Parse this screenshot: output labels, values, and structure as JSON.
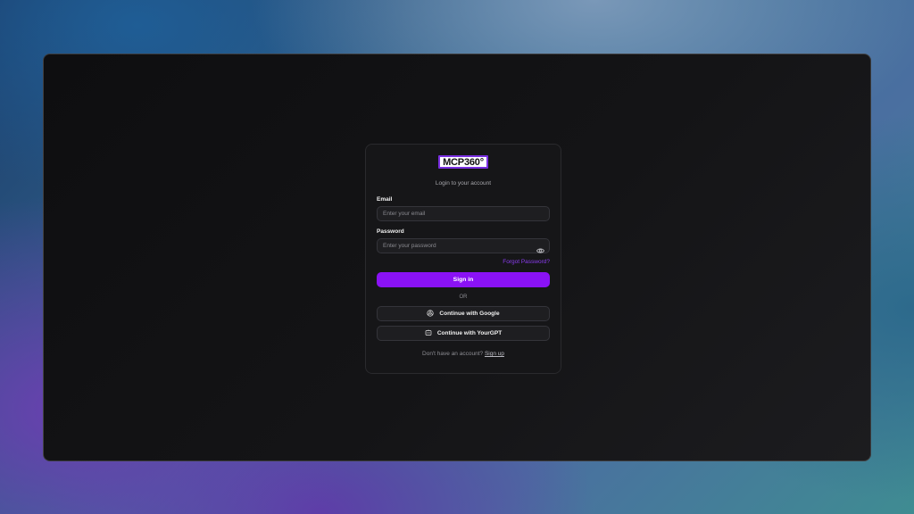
{
  "brand": {
    "logo_text": "MCP360°",
    "accent": "#8a12f5"
  },
  "login": {
    "subtitle": "Login to your account",
    "email_label": "Email",
    "email_placeholder": "Enter your email",
    "email_value": "",
    "password_label": "Password",
    "password_placeholder": "Enter your password",
    "password_value": "",
    "forgot_label": "Forgot Password?",
    "signin_label": "Sign in",
    "divider": "OR",
    "google_label": "Continue with Google",
    "yourgpt_label": "Continue with YourGPT",
    "footer_text": "Don't have an account?",
    "signup_label": "Sign up"
  },
  "icons": {
    "password_toggle": "eye-icon",
    "google": "google-icon",
    "yourgpt": "yourgpt-icon"
  }
}
